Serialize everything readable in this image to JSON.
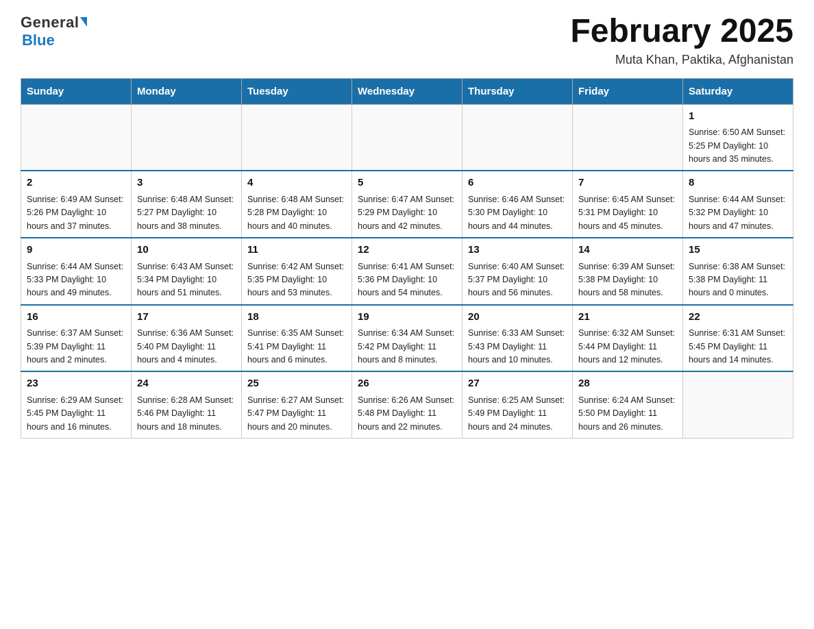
{
  "logo": {
    "general": "General",
    "blue": "Blue"
  },
  "title": "February 2025",
  "location": "Muta Khan, Paktika, Afghanistan",
  "days_of_week": [
    "Sunday",
    "Monday",
    "Tuesday",
    "Wednesday",
    "Thursday",
    "Friday",
    "Saturday"
  ],
  "weeks": [
    [
      {
        "day": "",
        "info": ""
      },
      {
        "day": "",
        "info": ""
      },
      {
        "day": "",
        "info": ""
      },
      {
        "day": "",
        "info": ""
      },
      {
        "day": "",
        "info": ""
      },
      {
        "day": "",
        "info": ""
      },
      {
        "day": "1",
        "info": "Sunrise: 6:50 AM\nSunset: 5:25 PM\nDaylight: 10 hours and 35 minutes."
      }
    ],
    [
      {
        "day": "2",
        "info": "Sunrise: 6:49 AM\nSunset: 5:26 PM\nDaylight: 10 hours and 37 minutes."
      },
      {
        "day": "3",
        "info": "Sunrise: 6:48 AM\nSunset: 5:27 PM\nDaylight: 10 hours and 38 minutes."
      },
      {
        "day": "4",
        "info": "Sunrise: 6:48 AM\nSunset: 5:28 PM\nDaylight: 10 hours and 40 minutes."
      },
      {
        "day": "5",
        "info": "Sunrise: 6:47 AM\nSunset: 5:29 PM\nDaylight: 10 hours and 42 minutes."
      },
      {
        "day": "6",
        "info": "Sunrise: 6:46 AM\nSunset: 5:30 PM\nDaylight: 10 hours and 44 minutes."
      },
      {
        "day": "7",
        "info": "Sunrise: 6:45 AM\nSunset: 5:31 PM\nDaylight: 10 hours and 45 minutes."
      },
      {
        "day": "8",
        "info": "Sunrise: 6:44 AM\nSunset: 5:32 PM\nDaylight: 10 hours and 47 minutes."
      }
    ],
    [
      {
        "day": "9",
        "info": "Sunrise: 6:44 AM\nSunset: 5:33 PM\nDaylight: 10 hours and 49 minutes."
      },
      {
        "day": "10",
        "info": "Sunrise: 6:43 AM\nSunset: 5:34 PM\nDaylight: 10 hours and 51 minutes."
      },
      {
        "day": "11",
        "info": "Sunrise: 6:42 AM\nSunset: 5:35 PM\nDaylight: 10 hours and 53 minutes."
      },
      {
        "day": "12",
        "info": "Sunrise: 6:41 AM\nSunset: 5:36 PM\nDaylight: 10 hours and 54 minutes."
      },
      {
        "day": "13",
        "info": "Sunrise: 6:40 AM\nSunset: 5:37 PM\nDaylight: 10 hours and 56 minutes."
      },
      {
        "day": "14",
        "info": "Sunrise: 6:39 AM\nSunset: 5:38 PM\nDaylight: 10 hours and 58 minutes."
      },
      {
        "day": "15",
        "info": "Sunrise: 6:38 AM\nSunset: 5:38 PM\nDaylight: 11 hours and 0 minutes."
      }
    ],
    [
      {
        "day": "16",
        "info": "Sunrise: 6:37 AM\nSunset: 5:39 PM\nDaylight: 11 hours and 2 minutes."
      },
      {
        "day": "17",
        "info": "Sunrise: 6:36 AM\nSunset: 5:40 PM\nDaylight: 11 hours and 4 minutes."
      },
      {
        "day": "18",
        "info": "Sunrise: 6:35 AM\nSunset: 5:41 PM\nDaylight: 11 hours and 6 minutes."
      },
      {
        "day": "19",
        "info": "Sunrise: 6:34 AM\nSunset: 5:42 PM\nDaylight: 11 hours and 8 minutes."
      },
      {
        "day": "20",
        "info": "Sunrise: 6:33 AM\nSunset: 5:43 PM\nDaylight: 11 hours and 10 minutes."
      },
      {
        "day": "21",
        "info": "Sunrise: 6:32 AM\nSunset: 5:44 PM\nDaylight: 11 hours and 12 minutes."
      },
      {
        "day": "22",
        "info": "Sunrise: 6:31 AM\nSunset: 5:45 PM\nDaylight: 11 hours and 14 minutes."
      }
    ],
    [
      {
        "day": "23",
        "info": "Sunrise: 6:29 AM\nSunset: 5:45 PM\nDaylight: 11 hours and 16 minutes."
      },
      {
        "day": "24",
        "info": "Sunrise: 6:28 AM\nSunset: 5:46 PM\nDaylight: 11 hours and 18 minutes."
      },
      {
        "day": "25",
        "info": "Sunrise: 6:27 AM\nSunset: 5:47 PM\nDaylight: 11 hours and 20 minutes."
      },
      {
        "day": "26",
        "info": "Sunrise: 6:26 AM\nSunset: 5:48 PM\nDaylight: 11 hours and 22 minutes."
      },
      {
        "day": "27",
        "info": "Sunrise: 6:25 AM\nSunset: 5:49 PM\nDaylight: 11 hours and 24 minutes."
      },
      {
        "day": "28",
        "info": "Sunrise: 6:24 AM\nSunset: 5:50 PM\nDaylight: 11 hours and 26 minutes."
      },
      {
        "day": "",
        "info": ""
      }
    ]
  ]
}
